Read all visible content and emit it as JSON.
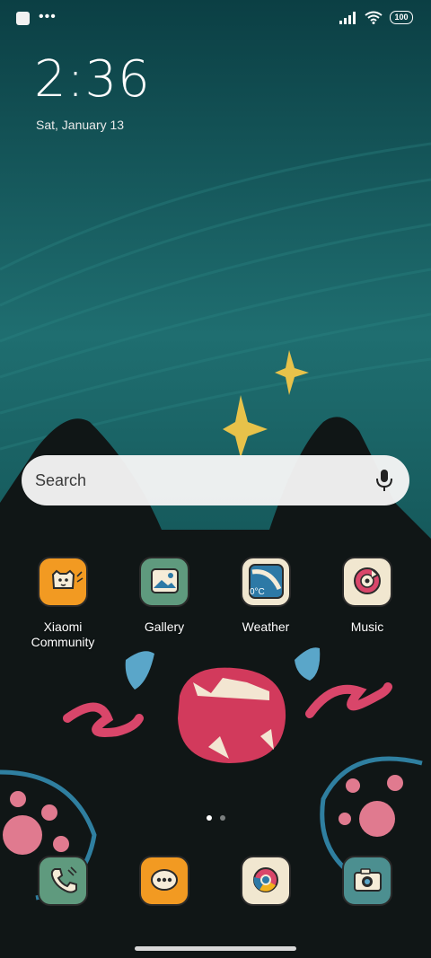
{
  "status": {
    "battery": "100"
  },
  "lockscreen": {
    "time": "2:36",
    "date": "Sat, January 13"
  },
  "search": {
    "placeholder": "Search"
  },
  "apps": [
    {
      "label": "Xiaomi\nCommunity",
      "icon": "xiaomi-community-icon",
      "color": "#f29a22"
    },
    {
      "label": "Gallery",
      "icon": "gallery-icon",
      "color": "#5f9a7e"
    },
    {
      "label": "Weather",
      "icon": "weather-icon",
      "color": "#f1e7d0",
      "temp": "0°C"
    },
    {
      "label": "Music",
      "icon": "music-icon",
      "color": "#f1e7d0"
    }
  ],
  "dock": [
    {
      "icon": "phone-icon",
      "color": "#5f9a7e"
    },
    {
      "icon": "messages-icon",
      "color": "#f29a22"
    },
    {
      "icon": "chrome-icon",
      "color": "#f1e7d0"
    },
    {
      "icon": "camera-icon",
      "color": "#4c8f90"
    }
  ],
  "pager": {
    "pages": 2,
    "current": 1
  }
}
